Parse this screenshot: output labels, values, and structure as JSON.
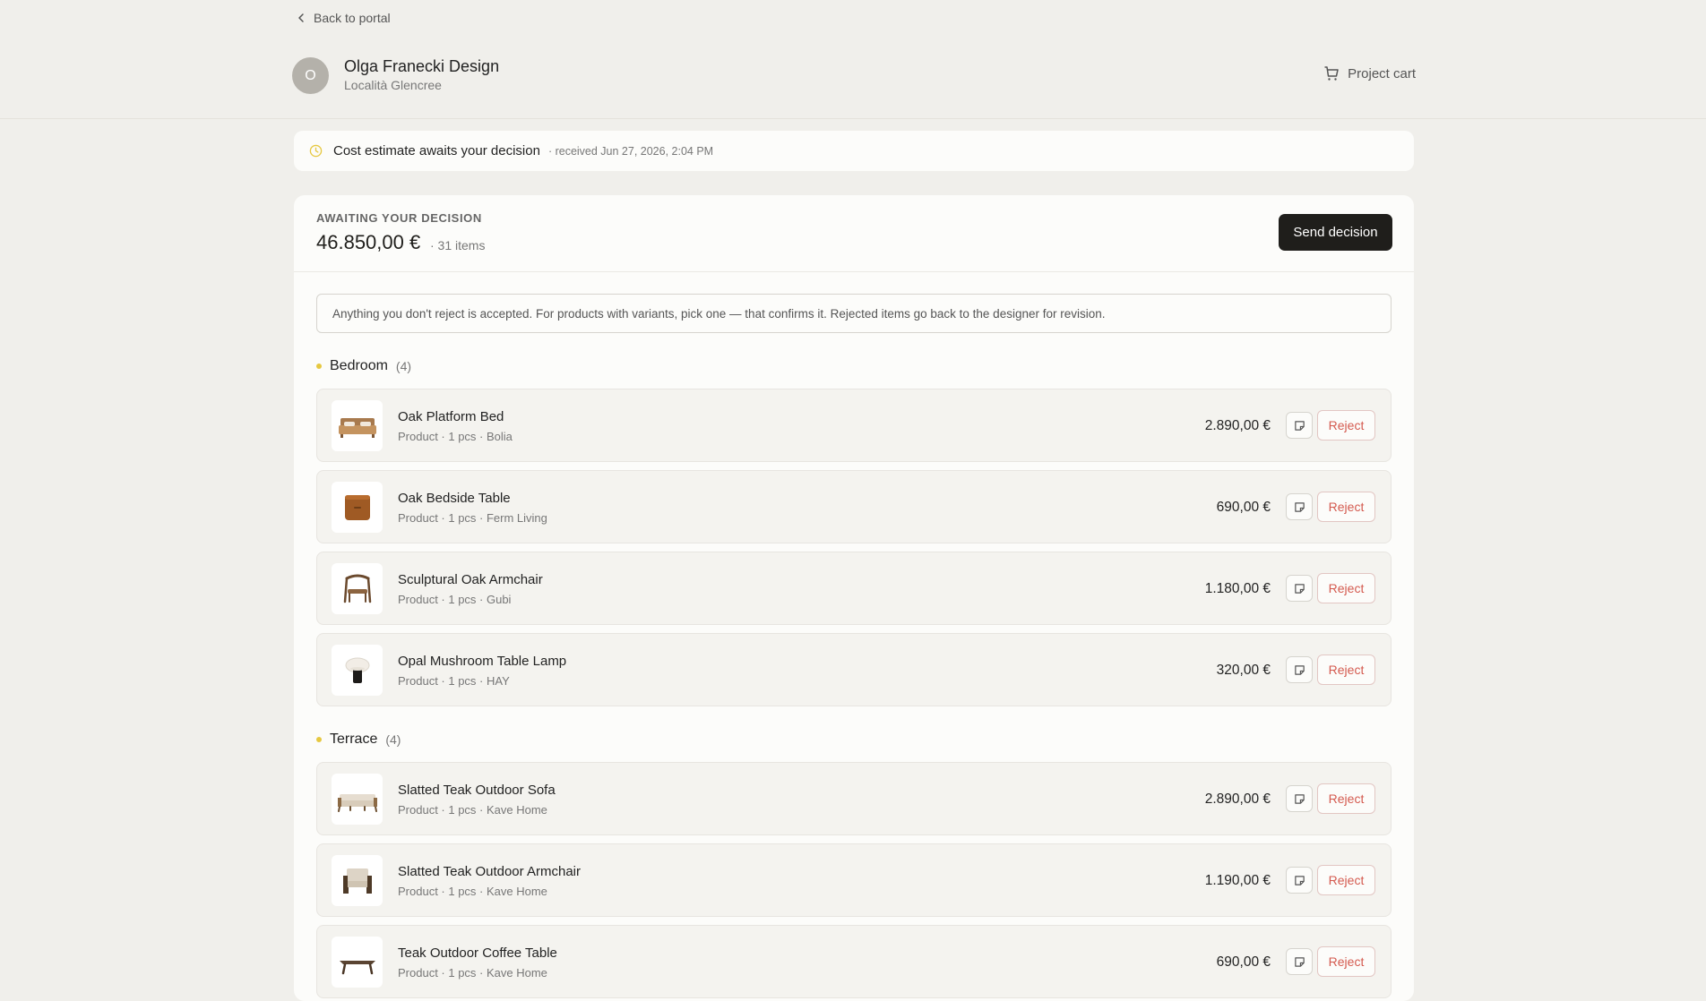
{
  "header": {
    "back_label": "Back to portal",
    "avatar_initial": "O",
    "studio_name": "Olga Franecki Design",
    "studio_location": "Località Glencree",
    "cart_label": "Project cart"
  },
  "notice": {
    "title": "Cost estimate awaits your decision",
    "received": "· received Jun 27, 2026, 2:04 PM"
  },
  "summary": {
    "label": "AWAITING YOUR DECISION",
    "total": "46.850,00 €",
    "items": "· 31 items",
    "send_button": "Send decision"
  },
  "info_text": "Anything you don't reject is accepted. For products with variants, pick one — that confirms it. Rejected items go back to the designer for revision.",
  "reject_label": "Reject",
  "sections": [
    {
      "name": "Bedroom",
      "count": "(4)",
      "items": [
        {
          "name": "Oak Platform Bed",
          "meta": "Product · 1 pcs · Bolia",
          "price": "2.890,00 €",
          "thumb": "bed"
        },
        {
          "name": "Oak Bedside Table",
          "meta": "Product · 1 pcs · Ferm Living",
          "price": "690,00 €",
          "thumb": "bedside-table"
        },
        {
          "name": "Sculptural Oak Armchair",
          "meta": "Product · 1 pcs · Gubi",
          "price": "1.180,00 €",
          "thumb": "armchair"
        },
        {
          "name": "Opal Mushroom Table Lamp",
          "meta": "Product · 1 pcs · HAY",
          "price": "320,00 €",
          "thumb": "lamp"
        }
      ]
    },
    {
      "name": "Terrace",
      "count": "(4)",
      "items": [
        {
          "name": "Slatted Teak Outdoor Sofa",
          "meta": "Product · 1 pcs · Kave Home",
          "price": "2.890,00 €",
          "thumb": "sofa"
        },
        {
          "name": "Slatted Teak Outdoor Armchair",
          "meta": "Product · 1 pcs · Kave Home",
          "price": "1.190,00 €",
          "thumb": "outdoor-armchair"
        },
        {
          "name": "Teak Outdoor Coffee Table",
          "meta": "Product · 1 pcs · Kave Home",
          "price": "690,00 €",
          "thumb": "coffee-table"
        }
      ]
    }
  ]
}
